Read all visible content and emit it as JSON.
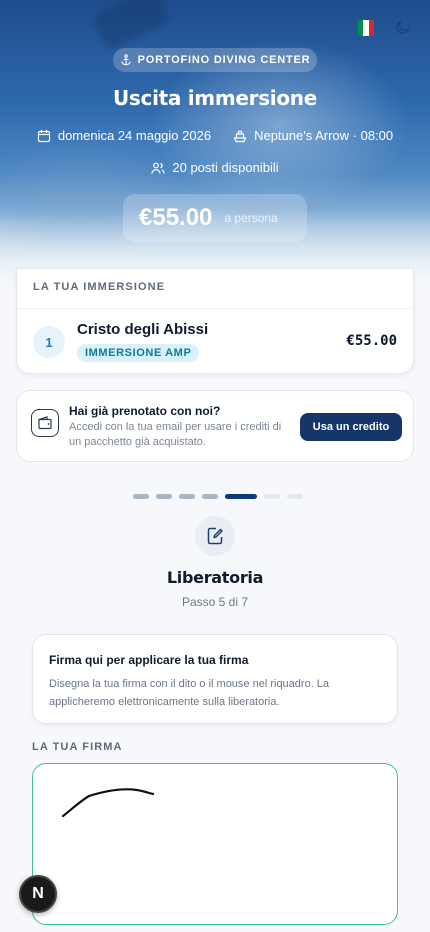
{
  "hero": {
    "center_name": "PORTOFINO DIVING CENTER",
    "title": "Uscita immersione",
    "date": "domenica 24 maggio 2026",
    "boat_time": "Neptune's Arrow · 08:00",
    "seats": "20 posti disponibili",
    "price": "€55.00",
    "price_unit": "a persona"
  },
  "language": {
    "flag_colors": [
      "#009246",
      "#ffffff",
      "#ce2b37"
    ]
  },
  "dive_card": {
    "header": "LA TUA IMMERSIONE",
    "items": [
      {
        "number": "1",
        "name": "Cristo degli Abissi",
        "tag": "IMMERSIONE AMP",
        "price": "€55.00"
      }
    ]
  },
  "credit": {
    "title": "Hai già prenotato con noi?",
    "subtitle": "Accedi con la tua email per usare i crediti di un pacchetto già acquistato.",
    "button": "Usa un credito"
  },
  "progress": {
    "total": 7,
    "current": 5
  },
  "step": {
    "title": "Liberatoria",
    "subtitle": "Passo 5 di 7"
  },
  "signature_info": {
    "title": "Firma qui per applicare la tua firma",
    "text": "Disegna la tua firma con il dito o il mouse nel riquadro. La applicheremo elettronicamente sulla liberatoria."
  },
  "signature": {
    "label": "LA TUA FIRMA"
  },
  "dev_badge": {
    "letter": "N"
  },
  "colors": {
    "primary": "#16366a",
    "accent_teal": "#3fbf94",
    "progress_done": "#a9b6c8",
    "progress_current": "#0f3a78",
    "progress_todo": "#e4e8ee"
  }
}
